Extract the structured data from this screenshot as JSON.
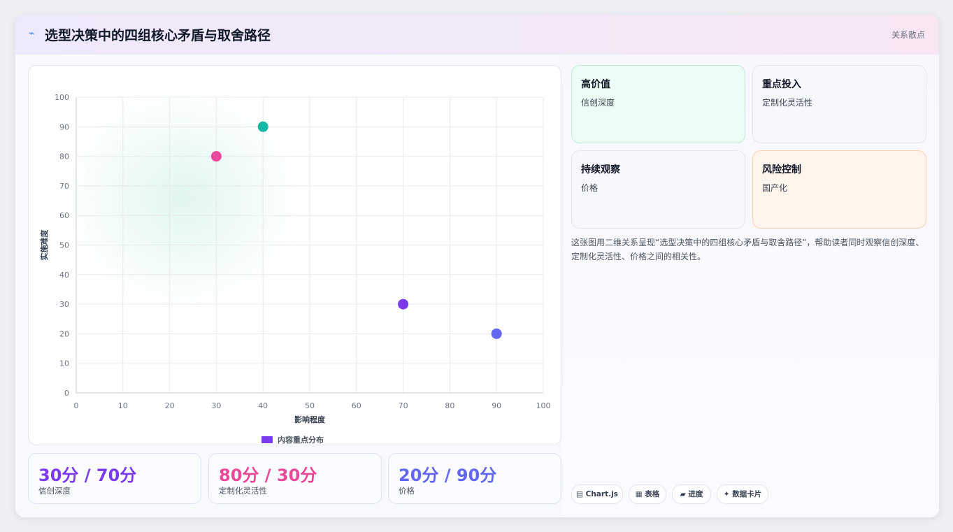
{
  "header": {
    "icon": "⌁",
    "title": "选型决策中的四组核心矛盾与取舍路径",
    "tag": "关系散点"
  },
  "chart_data": {
    "type": "scatter",
    "xlabel": "影响程度",
    "ylabel": "实施难度",
    "xlim": [
      0,
      100
    ],
    "ylim": [
      0,
      100
    ],
    "xticks": [
      "0",
      "10",
      "20",
      "30",
      "40",
      "50",
      "60",
      "70",
      "80",
      "90",
      "100"
    ],
    "yticks": [
      "0",
      "10",
      "20",
      "30",
      "40",
      "50",
      "60",
      "70",
      "80",
      "90",
      "100"
    ],
    "grid": true,
    "legend": {
      "placement": "bottom",
      "label": "内容重点分布",
      "color": "#7c3aed"
    },
    "points": [
      {
        "x": 30,
        "y": 80,
        "color": "#ec4899"
      },
      {
        "x": 40,
        "y": 90,
        "color": "#14b8a6"
      },
      {
        "x": 70,
        "y": 30,
        "color": "#7c3aed"
      },
      {
        "x": 90,
        "y": 20,
        "color": "#6366f1"
      }
    ]
  },
  "metrics": [
    {
      "value": "30分 / 70分",
      "label": "信创深度",
      "color": "#7c3aed"
    },
    {
      "value": "80分 / 30分",
      "label": "定制化灵活性",
      "color": "#ec4899"
    },
    {
      "value": "20分 / 90分",
      "label": "价格",
      "color": "#6366f1"
    }
  ],
  "quadrants": [
    {
      "title": "高价值",
      "sub": "信创深度"
    },
    {
      "title": "重点投入",
      "sub": "定制化灵活性"
    },
    {
      "title": "持续观察",
      "sub": "价格"
    },
    {
      "title": "风险控制",
      "sub": "国产化"
    }
  ],
  "description": "这张图用二维关系呈现“选型决策中的四组核心矛盾与取舍路径”，帮助读者同时观察信创深度、定制化灵活性、价格之间的相关性。",
  "pills": [
    "▤ Chart.js",
    "▦ 表格",
    "▰ 进度",
    "✦ 数据卡片"
  ]
}
